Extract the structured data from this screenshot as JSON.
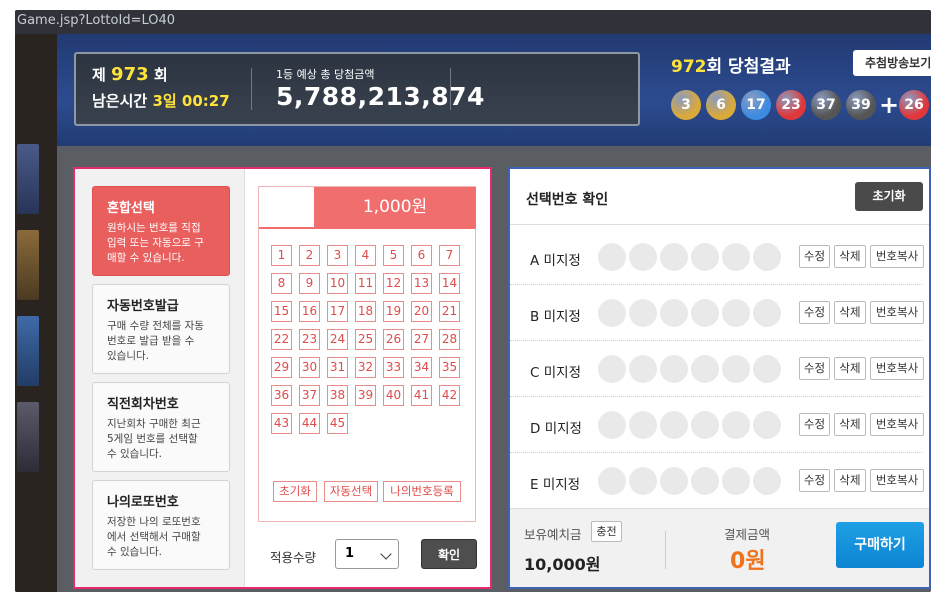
{
  "url": "Game.jsp?LottoId=LO40",
  "header": {
    "round_prefix": "제",
    "round_number": "973",
    "round_suffix": "회",
    "remaining_label": "남은시간",
    "remaining_days": "3일",
    "remaining_time": "00:27",
    "jackpot_label": "1등 예상 총 당첨금액",
    "jackpot_amount": "5,788,213,874",
    "result_round": "972",
    "result_suffix": "회 당첨결과",
    "broadcast_button": "추첨방송보기",
    "winning_numbers": [
      "3",
      "6",
      "17",
      "23",
      "37",
      "39"
    ],
    "bonus_number": "26",
    "ball_colors": [
      "#d9a93b",
      "#d9a93b",
      "#3d8be0",
      "#e0383a",
      "#555555",
      "#555555",
      "#e0383a"
    ]
  },
  "menu": [
    {
      "title": "혼합선택",
      "desc": [
        "원하시는 번호를 직접",
        "입력 또는 자동으로 구",
        "매할 수 있습니다."
      ]
    },
    {
      "title": "자동번호발급",
      "desc": [
        "구매 수량 전체를 자동",
        "번호로 발급 받을 수",
        "있습니다."
      ]
    },
    {
      "title": "직전회차번호",
      "desc": [
        "지난회차 구매한 최근",
        "5게임 번호를 선택할",
        "수 있습니다."
      ]
    },
    {
      "title": "나의로또번호",
      "desc": [
        "저장한 나의 로또번호",
        "에서 선택해서 구매할",
        "수 있습니다."
      ]
    }
  ],
  "picker": {
    "price": "1,000원",
    "numbers": [
      "1",
      "2",
      "3",
      "4",
      "5",
      "6",
      "7",
      "8",
      "9",
      "10",
      "11",
      "12",
      "13",
      "14",
      "15",
      "16",
      "17",
      "18",
      "19",
      "20",
      "21",
      "22",
      "23",
      "24",
      "25",
      "26",
      "27",
      "28",
      "29",
      "30",
      "31",
      "32",
      "33",
      "34",
      "35",
      "36",
      "37",
      "38",
      "39",
      "40",
      "41",
      "42",
      "43",
      "44",
      "45"
    ],
    "reset": "초기화",
    "auto": "자동선택",
    "register": "나의번호등록"
  },
  "quantity": {
    "label": "적용수량",
    "value": "1",
    "confirm": "확인"
  },
  "selection": {
    "title": "선택번호 확인",
    "reset": "초기화",
    "rows": [
      {
        "slot": "A",
        "status": "미지정"
      },
      {
        "slot": "B",
        "status": "미지정"
      },
      {
        "slot": "C",
        "status": "미지정"
      },
      {
        "slot": "D",
        "status": "미지정"
      },
      {
        "slot": "E",
        "status": "미지정"
      }
    ],
    "edit": "수정",
    "delete": "삭제",
    "copy": "번호복사"
  },
  "footer": {
    "balance_label": "보유예치금",
    "charge": "충전",
    "balance": "10,000원",
    "payment_label": "결제금액",
    "payment_value": "0",
    "payment_unit": "원",
    "buy": "구매하기"
  }
}
